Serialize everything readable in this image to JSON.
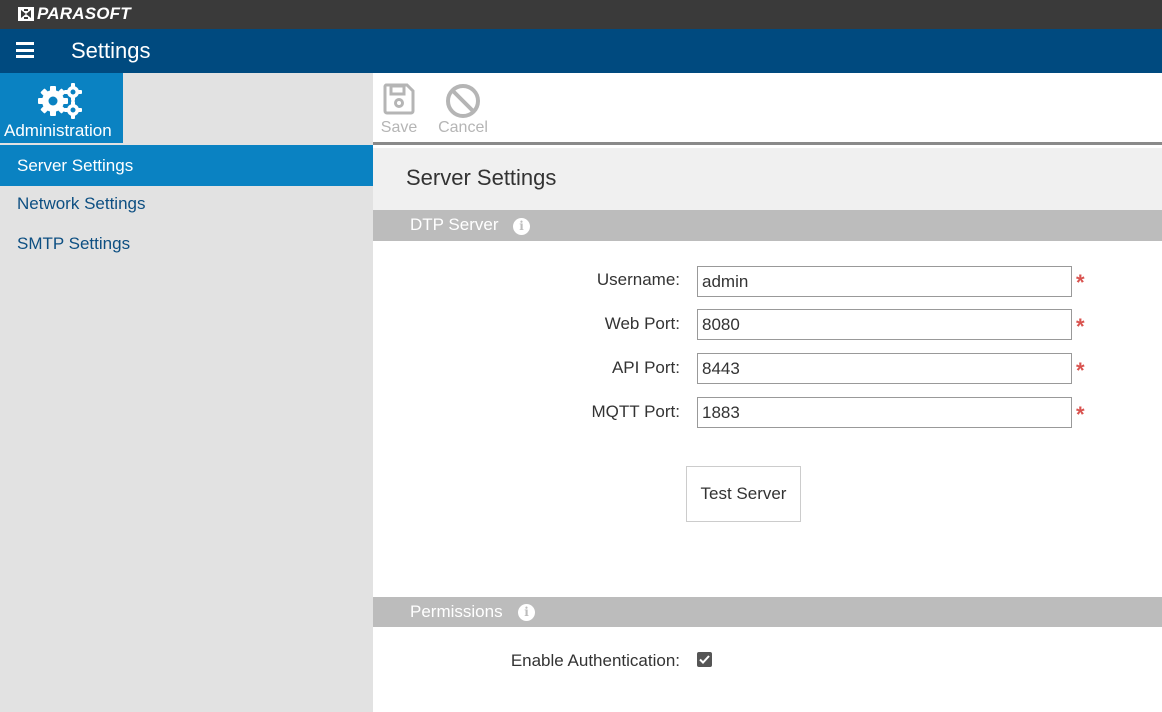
{
  "brand": {
    "name": "PARASOFT",
    "logo_icon": "parasoft-logo-icon"
  },
  "header": {
    "title": "Settings",
    "menu_icon": "hamburger-menu-icon"
  },
  "sidebar": {
    "admin_tile": {
      "label": "Administration",
      "icon": "gears-icon"
    },
    "items": [
      {
        "label": "Server Settings",
        "active": true
      },
      {
        "label": "Network Settings",
        "active": false
      },
      {
        "label": "SMTP Settings",
        "active": false
      }
    ]
  },
  "toolbar": {
    "save_label": "Save",
    "save_icon": "floppy-disk-icon",
    "cancel_label": "Cancel",
    "cancel_icon": "ban-icon"
  },
  "main": {
    "section_title": "Server Settings",
    "dtp_group": {
      "title": "DTP Server",
      "fields": [
        {
          "label": "Username:",
          "value": "admin",
          "required": true
        },
        {
          "label": "Web Port:",
          "value": "8080",
          "required": true
        },
        {
          "label": "API Port:",
          "value": "8443",
          "required": true
        },
        {
          "label": "MQTT Port:",
          "value": "1883",
          "required": true
        }
      ],
      "test_button_label": "Test Server"
    },
    "permissions_group": {
      "title": "Permissions",
      "enable_auth_label": "Enable Authentication:",
      "enable_auth_checked": true
    }
  },
  "colors": {
    "brand_bar": "#3a3a3a",
    "header_bar": "#004a7f",
    "accent": "#0a82c2",
    "required": "#d9534f"
  }
}
